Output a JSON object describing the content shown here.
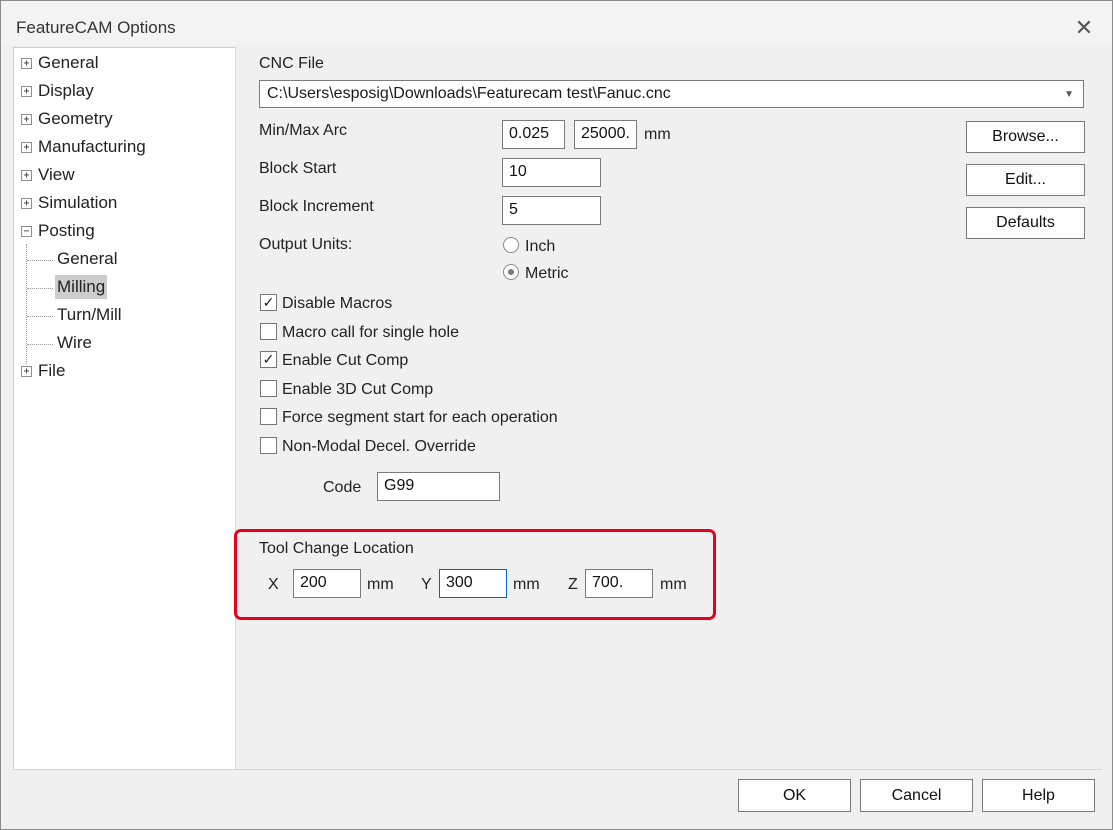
{
  "window": {
    "title": "FeatureCAM Options"
  },
  "tree": {
    "items": [
      {
        "label": "General",
        "toggle": "+"
      },
      {
        "label": "Display",
        "toggle": "+"
      },
      {
        "label": "Geometry",
        "toggle": "+"
      },
      {
        "label": "Manufacturing",
        "toggle": "+"
      },
      {
        "label": "View",
        "toggle": "+"
      },
      {
        "label": "Simulation",
        "toggle": "+"
      },
      {
        "label": "Posting",
        "toggle": "−"
      },
      {
        "label": "General"
      },
      {
        "label": "Milling"
      },
      {
        "label": "Turn/Mill"
      },
      {
        "label": "Wire"
      },
      {
        "label": "File",
        "toggle": "+"
      }
    ],
    "selected": "Milling"
  },
  "cnc": {
    "label": "CNC File",
    "value": "C:\\Users\\esposig\\Downloads\\Featurecam test\\Fanuc.cnc"
  },
  "arc": {
    "label": "Min/Max Arc",
    "min": "0.025",
    "max": "25000.",
    "unit": "mm"
  },
  "block_start": {
    "label": "Block Start",
    "value": "10"
  },
  "block_increment": {
    "label": "Block Increment",
    "value": "5"
  },
  "units": {
    "label": "Output Units:",
    "options": [
      "Inch",
      "Metric"
    ],
    "selected": "Metric"
  },
  "checks": [
    {
      "label": "Disable Macros",
      "checked": true
    },
    {
      "label": "Macro call for single hole",
      "checked": false
    },
    {
      "label": "Enable Cut Comp",
      "checked": true
    },
    {
      "label": "Enable 3D Cut Comp",
      "checked": false
    },
    {
      "label": "Force segment start for each operation",
      "checked": false
    },
    {
      "label": "Non-Modal Decel. Override",
      "checked": false
    }
  ],
  "code": {
    "label": "Code",
    "value": "G99"
  },
  "tool_change": {
    "label": "Tool Change Location",
    "x_label": "X",
    "x": "200",
    "y_label": "Y",
    "y": "300",
    "z_label": "Z",
    "z": "700.",
    "unit": "mm"
  },
  "side_buttons": {
    "browse": "Browse...",
    "edit": "Edit...",
    "defaults": "Defaults"
  },
  "footer": {
    "ok": "OK",
    "cancel": "Cancel",
    "help": "Help"
  },
  "colors": {
    "highlight": "#e8001c",
    "selection": "#cccccc"
  }
}
